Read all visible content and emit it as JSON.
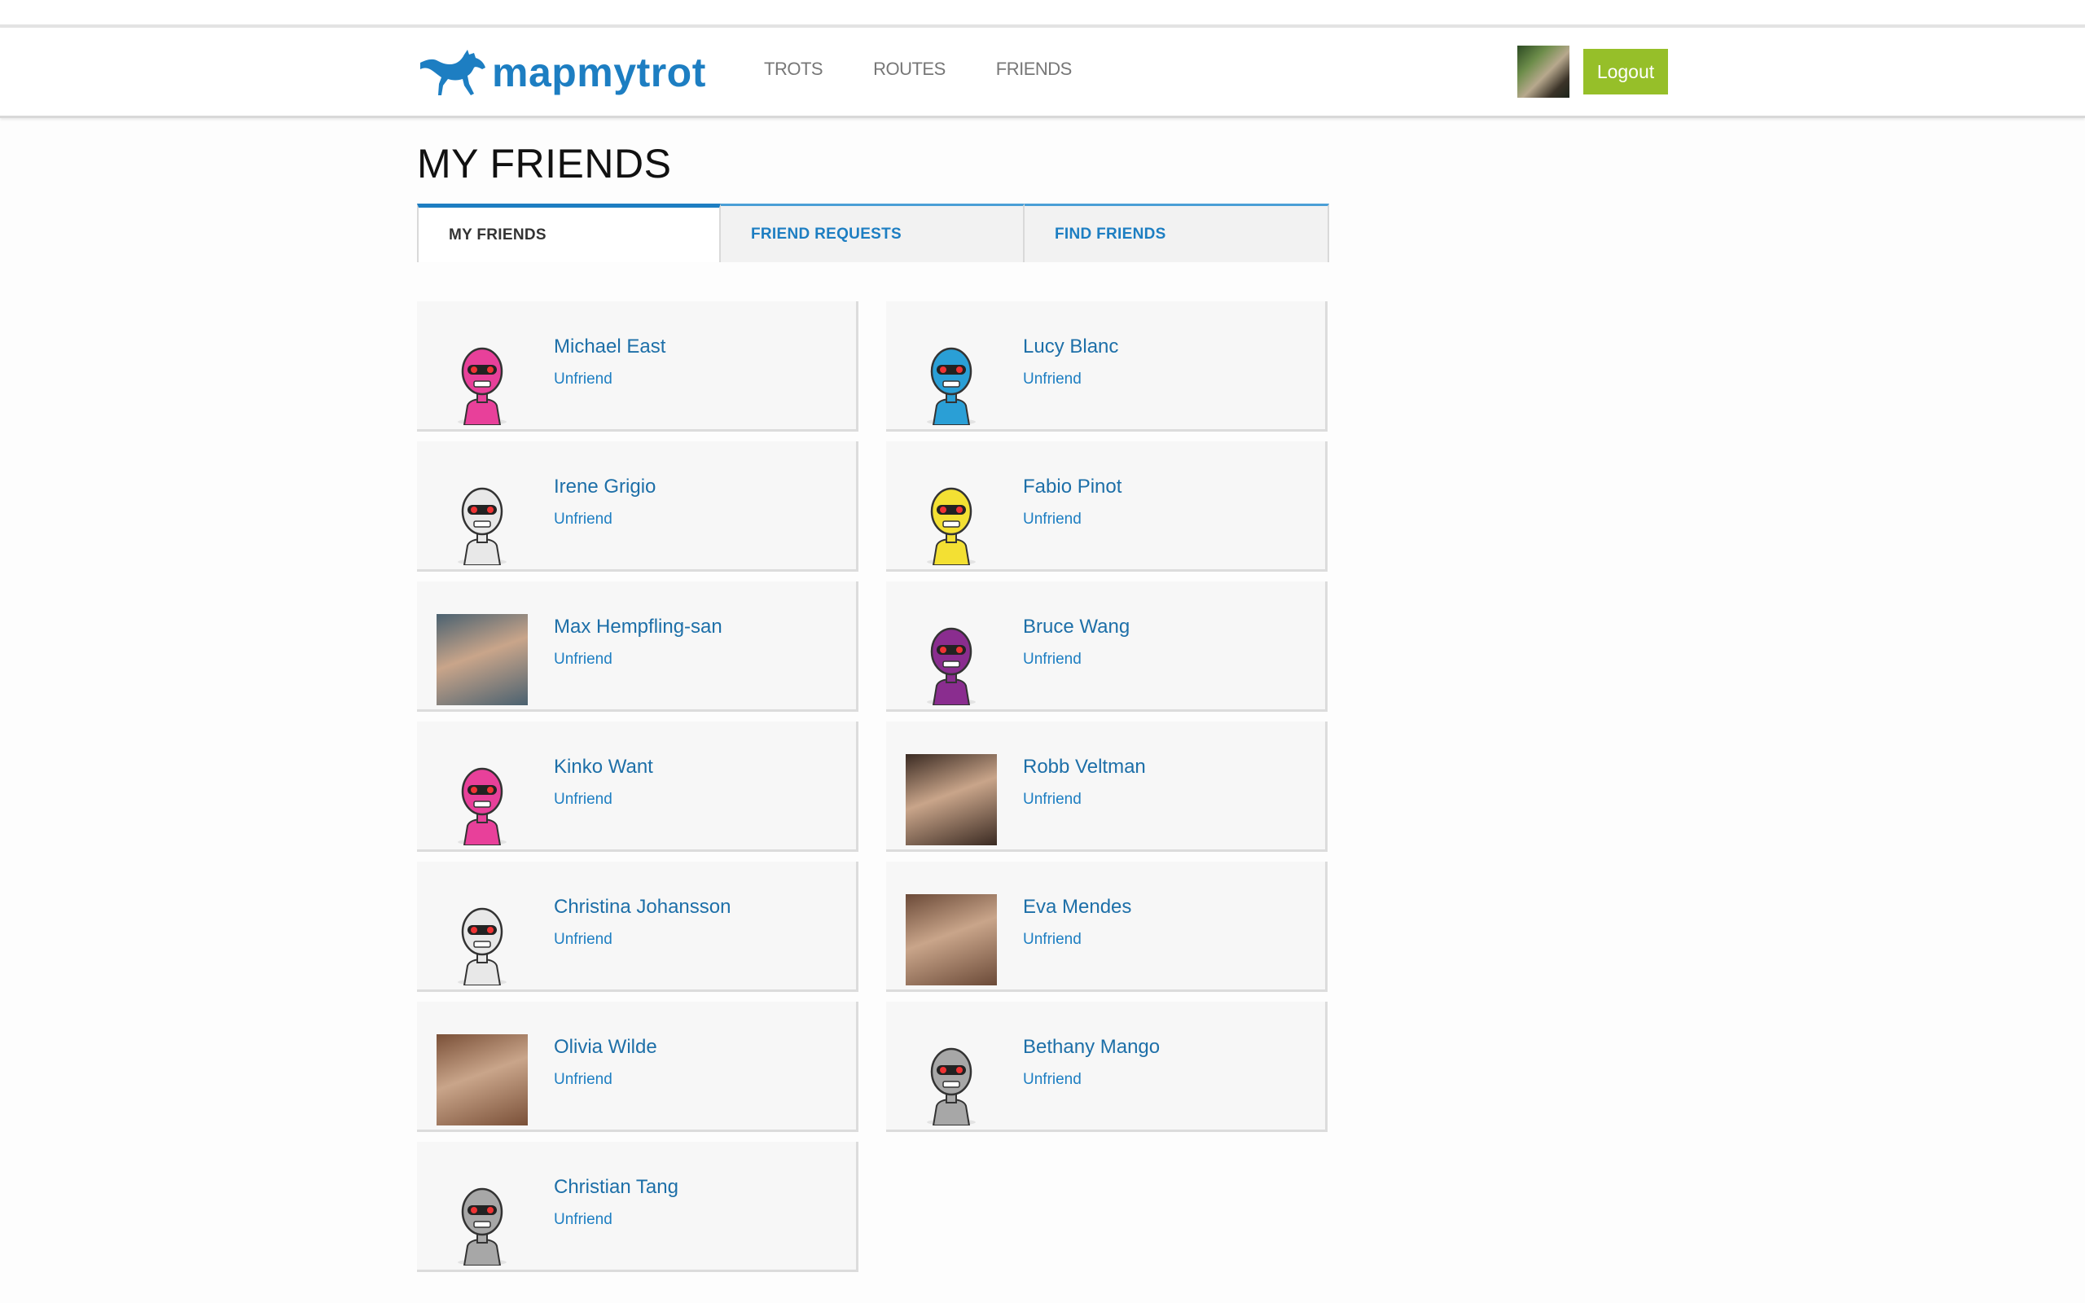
{
  "brand": {
    "name": "mapmytrot",
    "color": "#1d7ec2"
  },
  "nav": [
    "TROTS",
    "ROUTES",
    "FRIENDS"
  ],
  "header": {
    "logout_label": "Logout",
    "logout_color": "#96bf29"
  },
  "page_title": "MY FRIENDS",
  "tabs": [
    {
      "label": "MY FRIENDS",
      "active": true
    },
    {
      "label": "FRIEND REQUESTS",
      "active": false
    },
    {
      "label": "FIND FRIENDS",
      "active": false
    }
  ],
  "unfriend_label": "Unfriend",
  "friends": [
    {
      "name": "Michael East",
      "avatar": "robot-pink-icon",
      "color": "#e8409a"
    },
    {
      "name": "Lucy Blanc",
      "avatar": "robot-blue-icon",
      "color": "#2a9fd6"
    },
    {
      "name": "Irene Grigio",
      "avatar": "robot-white-icon",
      "color": "#e8e8e8"
    },
    {
      "name": "Fabio Pinot",
      "avatar": "robot-yellow-icon",
      "color": "#f3e033"
    },
    {
      "name": "Max Hempfling-san",
      "avatar": "photo",
      "color": "#4a6170"
    },
    {
      "name": "Bruce Wang",
      "avatar": "robot-purple-icon",
      "color": "#8a2d8f"
    },
    {
      "name": "Kinko Want",
      "avatar": "robot-pink-icon",
      "color": "#e8409a"
    },
    {
      "name": "Robb Veltman",
      "avatar": "photo",
      "color": "#3a2a22"
    },
    {
      "name": "Christina Johansson",
      "avatar": "robot-white-icon",
      "color": "#e8e8e8"
    },
    {
      "name": "Eva Mendes",
      "avatar": "photo",
      "color": "#6b4a38"
    },
    {
      "name": "Olivia Wilde",
      "avatar": "photo",
      "color": "#7a5038"
    },
    {
      "name": "Bethany Mango",
      "avatar": "robot-grey-icon",
      "color": "#a7a7a7"
    },
    {
      "name": "Christian Tang",
      "avatar": "robot-grey-icon",
      "color": "#a7a7a7"
    }
  ]
}
